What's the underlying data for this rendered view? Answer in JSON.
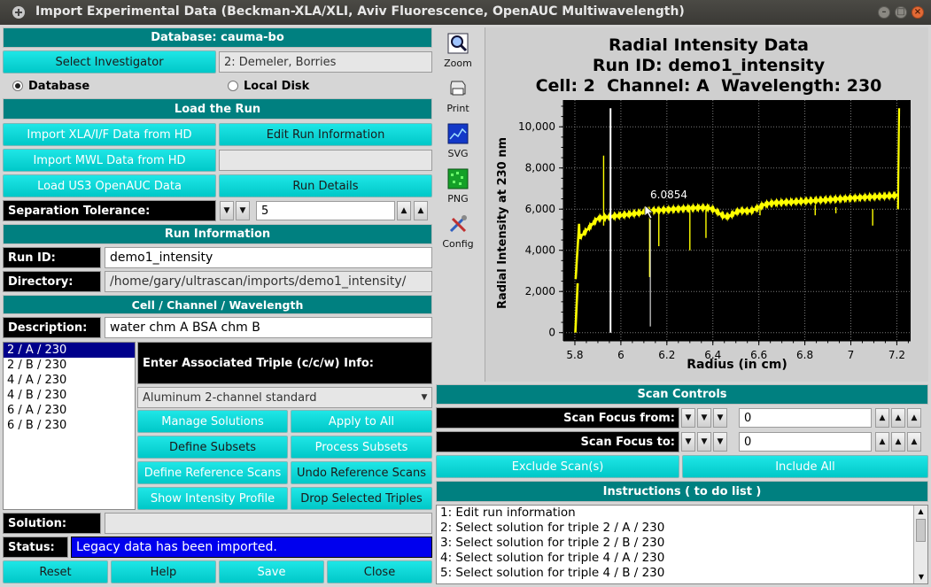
{
  "window": {
    "title": "Import Experimental Data (Beckman-XLA/XLI, Aviv Fluorescence, OpenAUC Multiwavelength)"
  },
  "database": {
    "header": "Database: cauma-bo",
    "select_investigator": "Select Investigator",
    "investigator": "2: Demeler, Borries",
    "radio_database": "Database",
    "radio_local": "Local Disk"
  },
  "load": {
    "header": "Load the Run",
    "import_xla": "Import XLA/I/F Data from HD",
    "edit_run_info": "Edit Run Information",
    "import_mwl": "Import MWL Data from HD",
    "load_us3": "Load US3 OpenAUC Data",
    "run_details": "Run Details",
    "sep_tol_label": "Separation Tolerance:",
    "sep_tol_value": "5"
  },
  "run_info": {
    "header": "Run Information",
    "run_id_label": "Run ID:",
    "run_id": "demo1_intensity",
    "dir_label": "Directory:",
    "directory": "/home/gary/ultrascan/imports/demo1_intensity/"
  },
  "ccw": {
    "header": "Cell / Channel / Wavelength",
    "desc_label": "Description:",
    "description": "water chm A BSA chm B",
    "triples": [
      "2 / A / 230",
      "2 / B / 230",
      "4 / A / 230",
      "4 / B / 230",
      "6 / A / 230",
      "6 / B / 230"
    ],
    "assoc_label": "Enter Associated Triple (c/c/w) Info:",
    "centerpiece": "Aluminum 2-channel standard",
    "manage_solutions": "Manage Solutions",
    "apply_all": "Apply to All",
    "define_subsets": "Define Subsets",
    "process_subsets": "Process Subsets",
    "define_ref": "Define Reference Scans",
    "undo_ref": "Undo Reference Scans",
    "show_profile": "Show Intensity Profile",
    "drop_triples": "Drop Selected Triples",
    "solution_label": "Solution:",
    "solution": "",
    "status_label": "Status:",
    "status": "Legacy data has been imported."
  },
  "footer": {
    "reset": "Reset",
    "help": "Help",
    "save": "Save",
    "close": "Close"
  },
  "tools": [
    {
      "label": "Zoom",
      "icon": "zoom-icon"
    },
    {
      "label": "Print",
      "icon": "print-icon"
    },
    {
      "label": "SVG",
      "icon": "svg-icon"
    },
    {
      "label": "PNG",
      "icon": "png-icon"
    },
    {
      "label": "Config",
      "icon": "config-icon"
    }
  ],
  "plot": {
    "title1": "Radial Intensity Data",
    "title2": "Run ID: demo1_intensity",
    "title3": "Cell: 2  Channel: A  Wavelength: 230",
    "xlabel": "Radius (in cm)",
    "ylabel": "Radial Intensity at 230 nm",
    "xticks": [
      "5.8",
      "6",
      "6.2",
      "6.4",
      "6.6",
      "6.8",
      "7",
      "7.2"
    ],
    "yticks": [
      "0",
      "2,000",
      "4,000",
      "6,000",
      "8,000",
      "10,000"
    ],
    "cursor_readout": "6.0854",
    "xlim": [
      5.75,
      7.26
    ],
    "ylim": [
      -400,
      11300
    ],
    "curve_color": "#ffff00",
    "background": "#000000"
  },
  "scan": {
    "header": "Scan Controls",
    "from_label": "Scan Focus from:",
    "from_value": "0",
    "to_label": "Scan Focus to:",
    "to_value": "0",
    "exclude": "Exclude Scan(s)",
    "include_all": "Include All"
  },
  "instructions": {
    "header": "Instructions ( to do list )",
    "items": [
      "1: Edit run information",
      "2: Select solution for triple 2 / A / 230",
      "3: Select solution for triple 2 / B / 230",
      "4: Select solution for triple 4 / A / 230",
      "5: Select solution for triple 4 / B / 230"
    ]
  }
}
